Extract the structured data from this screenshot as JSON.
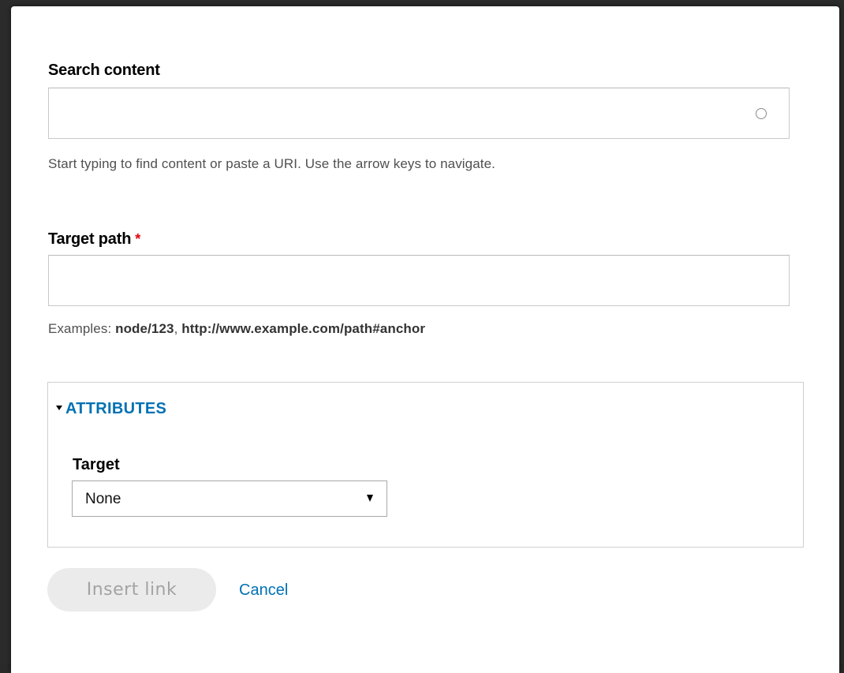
{
  "dialog": {
    "search": {
      "label": "Search content",
      "value": "",
      "help": "Start typing to find content or paste a URI. Use the arrow keys to navigate."
    },
    "target_path": {
      "label": "Target path",
      "required_marker": "*",
      "value": "",
      "help_prefix": "Examples:",
      "example_1": "node/123",
      "example_separator": ",",
      "example_2": "http://www.example.com/path#anchor"
    },
    "attributes": {
      "summary": "ATTRIBUTES",
      "target": {
        "label": "Target",
        "selected": "None"
      }
    },
    "actions": {
      "insert_label": "Insert link",
      "cancel_label": "Cancel"
    }
  },
  "colors": {
    "link": "#0071b3",
    "required": "#e3000b",
    "button_disabled_bg": "#ebebeb",
    "button_disabled_text": "#a3a3a3"
  },
  "icons": {
    "autocomplete": "circle-icon",
    "details_toggle": "triangle-down-icon",
    "select_caret": "caret-down-icon"
  }
}
